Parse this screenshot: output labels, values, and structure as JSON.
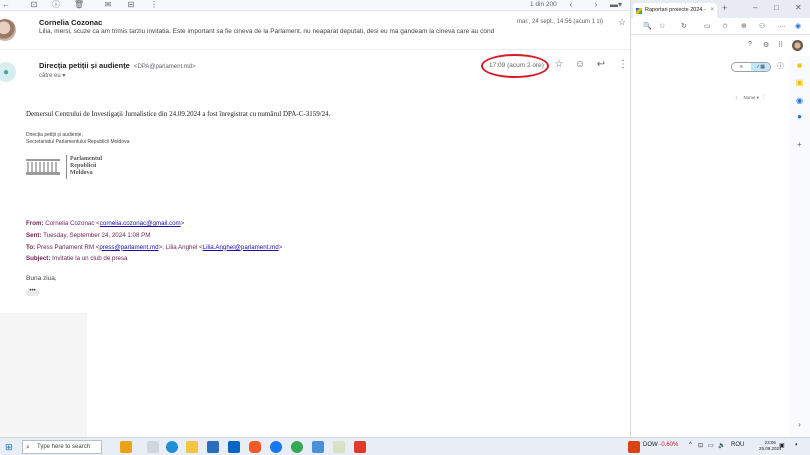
{
  "gmail": {
    "toolbar": {
      "icons": [
        "back-arrow-icon",
        "archive-icon",
        "report-spam-icon",
        "delete-icon",
        "mark-unread-icon",
        "move-to-icon",
        "more-vert-icon"
      ],
      "counter": "1 din 200"
    },
    "message1": {
      "sender": "Cornelia Cozonac",
      "snippet": "Lilia, mersi, scuze ca am trimis tarziu invitatia. Este important sa fie cineva de la Parlament, nu neaparat deputati, desi eu ma gandeam la cineva care au cond",
      "date": "mar., 24 sept., 14:56 (acum 1 zi)"
    },
    "message2": {
      "sender": "Direcția petiții și audiențe",
      "address": "<DPA@parlament.md>",
      "to": "către eu ▾",
      "time": "17:09 (acum 2 ore)",
      "body_main": "Demersul Centrului de Investigații Jurnalistice din 24.09.2024 a fost înregistrat cu numărul DPA-C-3159/24.",
      "signature_line1": "Direcția petiții și audiențe,",
      "signature_line2": "Secretariatul Parlamentului Republicii Moldova",
      "logo_line1": "Parlamentul",
      "logo_line2": "Republicii",
      "logo_line3": "Moldova",
      "forwarded": {
        "from_label": "From:",
        "from_name": "Cornelia Cozonac <",
        "from_email": "cornelia.cozonac@gmail.com",
        "from_close": ">",
        "sent_label": "Sent:",
        "sent_value": "Tuesday, September 24, 2024 1:08 PM",
        "to_label": "To:",
        "to_name1": "Press Parlament RM <",
        "to_email1": "press@parlament.md",
        "to_sep": ">; Lilia Anghel <",
        "to_email2": "Lilia.Anghel@parlament.md",
        "to_close": ">",
        "subject_label": "Subject:",
        "subject_value": "Invitatie la un club de presa"
      },
      "greeting": "Buna ziua,",
      "trimmed": "•••"
    }
  },
  "chrome": {
    "tab_title": "Raportari proiecte 2024 -",
    "tab_close": "×",
    "new_tab": "+",
    "win_min": "–",
    "win_max": "□",
    "win_close": "✕",
    "view_toggle": [
      "≡",
      "✓▦"
    ],
    "sort_label": "Nume ▾"
  },
  "taskbar": {
    "search_placeholder": "Type here to search",
    "stock_name": "DOW",
    "stock_change": "-0.60%",
    "language": "ROU",
    "time": "23:06",
    "date": "25.09.2024"
  },
  "colors": {
    "annotation_ring": "#d61d24",
    "forward_text": "#6b1f4f",
    "link": "#1a0dab"
  }
}
